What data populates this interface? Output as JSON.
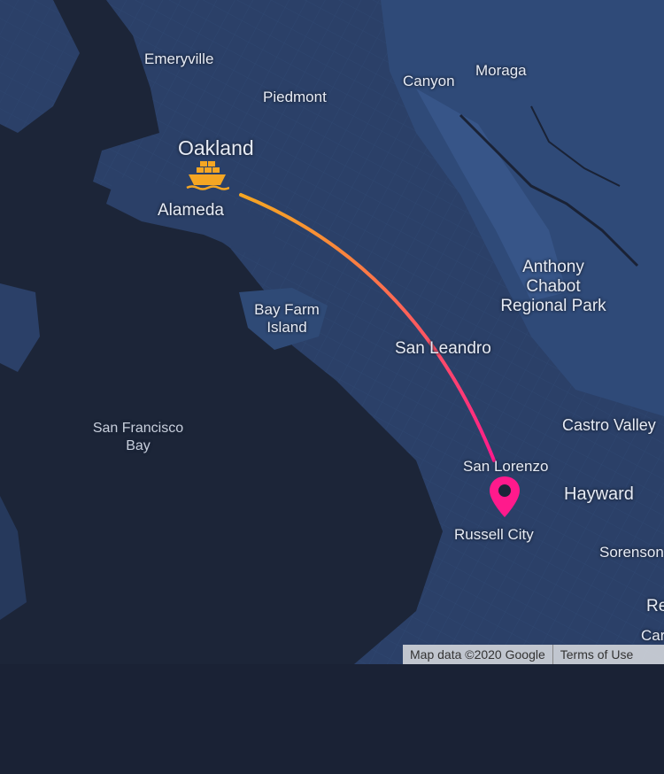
{
  "map": {
    "places": {
      "emeryville": "Emeryville",
      "piedmont": "Piedmont",
      "canyon": "Canyon",
      "moraga": "Moraga",
      "oakland": "Oakland",
      "alameda": "Alameda",
      "anthony_chabot_1": "Anthony",
      "anthony_chabot_2": "Chabot",
      "anthony_chabot_3": "Regional Park",
      "bay_farm_1": "Bay Farm",
      "bay_farm_2": "Island",
      "san_leandro": "San Leandro",
      "sf_bay_1": "San Francisco",
      "sf_bay_2": "Bay",
      "castro_valley": "Castro Valley",
      "san_lorenzo": "San Lorenzo",
      "hayward": "Hayward",
      "russell_city": "Russell City",
      "sorenson": "Sorenson",
      "re": "Re",
      "car": "Car"
    },
    "route": {
      "origin_icon": "cargo-ship-icon",
      "destination_icon": "map-pin-icon",
      "gradient_start": "#f5a623",
      "gradient_end": "#ff1a8c"
    },
    "attribution": {
      "map_data": "Map data ©2020 Google",
      "terms": "Terms of Use"
    }
  }
}
